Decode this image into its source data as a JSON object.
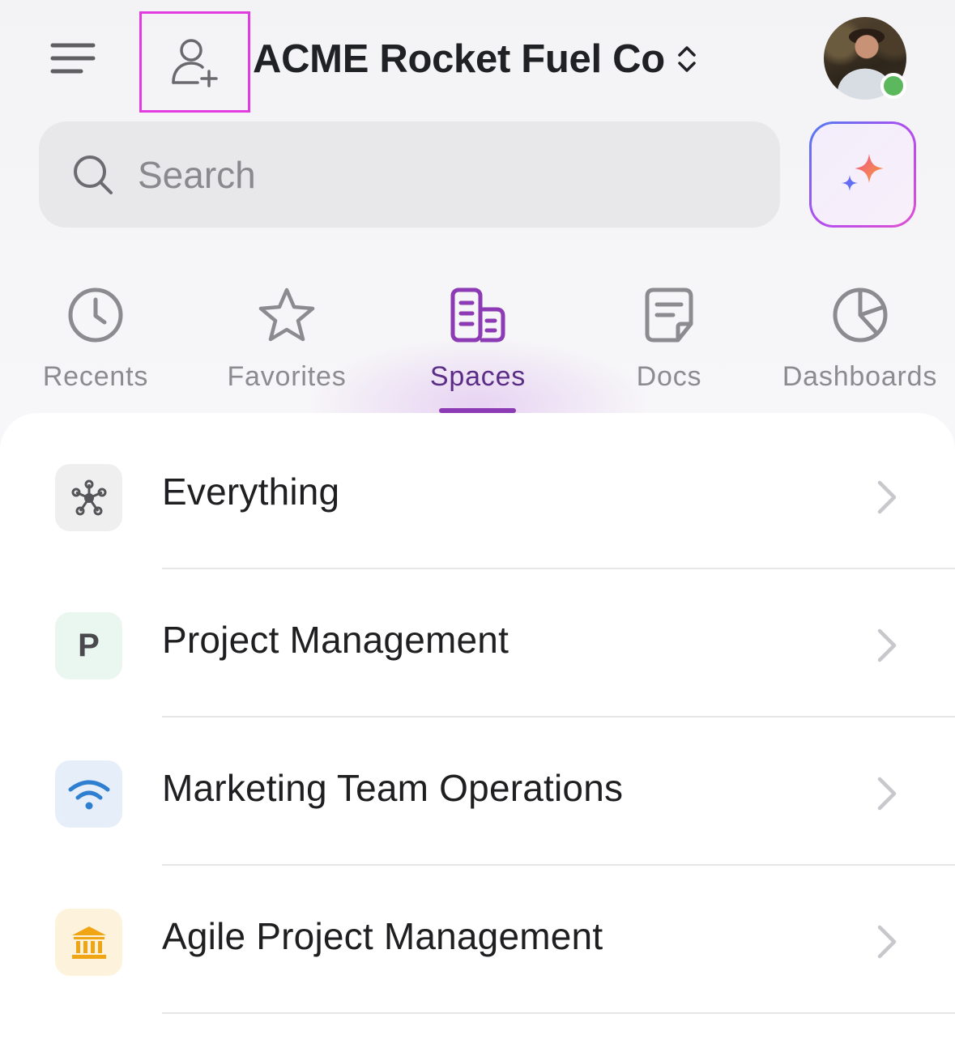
{
  "header": {
    "workspace_name": "ACME Rocket Fuel Co"
  },
  "search": {
    "placeholder": "Search"
  },
  "tabs": [
    {
      "label": "Recents",
      "icon": "clock-icon",
      "active": false
    },
    {
      "label": "Favorites",
      "icon": "star-icon",
      "active": false
    },
    {
      "label": "Spaces",
      "icon": "spaces-icon",
      "active": true
    },
    {
      "label": "Docs",
      "icon": "doc-icon",
      "active": false
    },
    {
      "label": "Dashboards",
      "icon": "pie-chart-icon",
      "active": false
    }
  ],
  "spaces": [
    {
      "label": "Everything",
      "icon": "hub-icon",
      "icon_bg": "#efefef"
    },
    {
      "label": "Project Management",
      "icon": "letter-avatar",
      "letter": "P",
      "icon_bg": "#eaf6f0"
    },
    {
      "label": "Marketing Team Operations",
      "icon": "wifi-icon",
      "icon_bg": "#e6eff9"
    },
    {
      "label": "Agile Project Management",
      "icon": "bank-icon",
      "icon_bg": "#fdf3dc"
    }
  ],
  "colors": {
    "accent": "#8c3bb5",
    "highlight_border": "#e23ce0",
    "status_online": "#5cb85c"
  }
}
